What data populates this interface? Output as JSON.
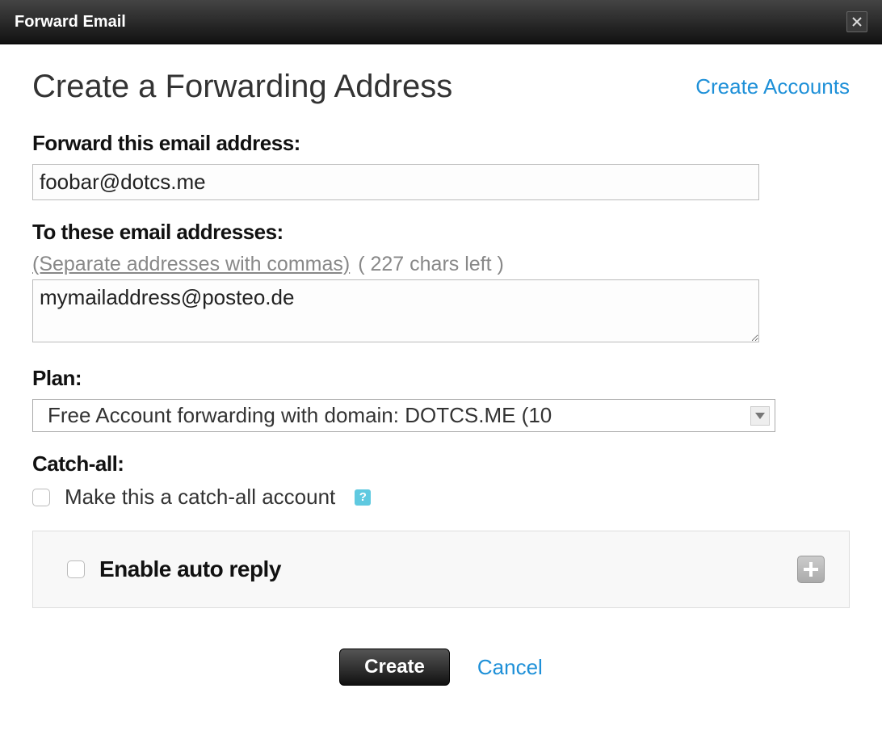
{
  "window": {
    "title": "Forward Email"
  },
  "header": {
    "title": "Create a Forwarding Address",
    "create_accounts_link": "Create Accounts"
  },
  "form": {
    "forward_label": "Forward this email address:",
    "forward_value": "foobar@dotcs.me",
    "to_label": "To these email addresses:",
    "to_hint": "(Separate addresses with commas)",
    "to_chars_left": "( 227 chars left )",
    "to_value": "mymailaddress@posteo.de",
    "plan_label": "Plan:",
    "plan_selected": "Free Account forwarding with domain: DOTCS.ME (10",
    "catchall_label": "Catch-all:",
    "catchall_checkbox_label": "Make this a catch-all account",
    "autoreply_label": "Enable auto reply"
  },
  "footer": {
    "create_label": "Create",
    "cancel_label": "Cancel"
  }
}
